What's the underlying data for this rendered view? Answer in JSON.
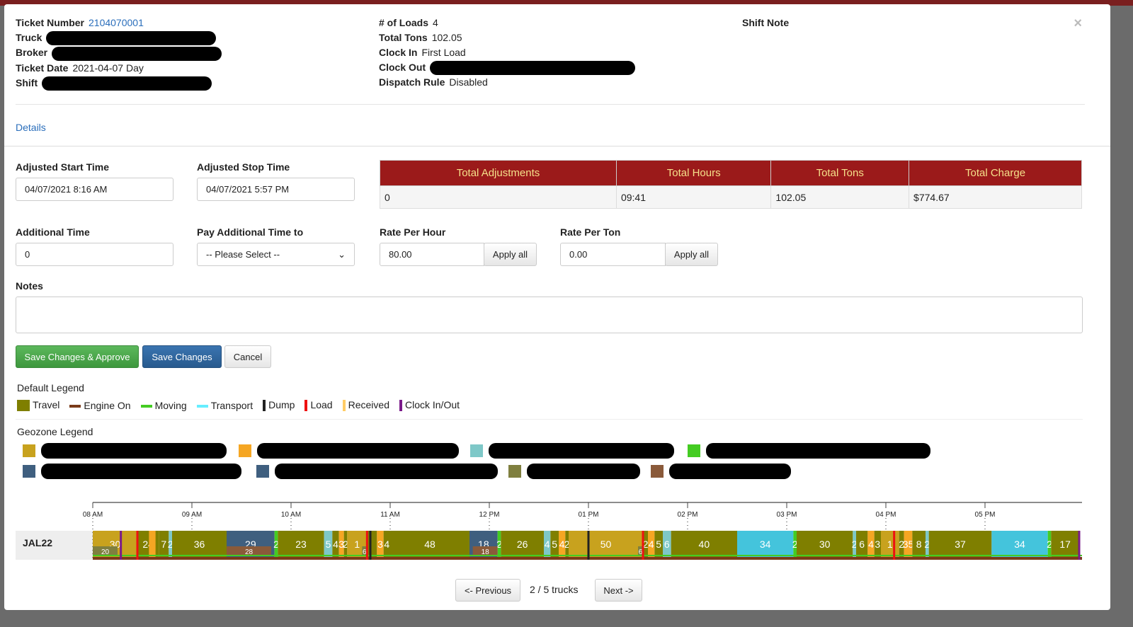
{
  "header": {
    "ticket_number_label": "Ticket Number",
    "ticket_number": "2104070001",
    "truck_label": "Truck",
    "broker_label": "Broker",
    "ticket_date_label": "Ticket Date",
    "ticket_date": "2021-04-07 Day",
    "shift_label": "Shift",
    "loads_label": "# of Loads",
    "loads": "4",
    "total_tons_label": "Total Tons",
    "total_tons": "102.05",
    "clock_in_label": "Clock In",
    "clock_in": "First Load",
    "clock_out_label": "Clock Out",
    "dispatch_rule_label": "Dispatch Rule",
    "dispatch_rule": "Disabled",
    "shift_note_label": "Shift Note",
    "close": "×"
  },
  "details_link": "Details",
  "form": {
    "adj_start_label": "Adjusted Start Time",
    "adj_start": "04/07/2021 8:16 AM",
    "adj_stop_label": "Adjusted Stop Time",
    "adj_stop": "04/07/2021 5:57 PM",
    "additional_time_label": "Additional Time",
    "additional_time": "0",
    "pay_additional_label": "Pay Additional Time to",
    "pay_additional": "-- Please Select --",
    "rate_hour_label": "Rate Per Hour",
    "rate_hour": "80.00",
    "rate_ton_label": "Rate Per Ton",
    "rate_ton": "0.00",
    "apply_all": "Apply all",
    "notes_label": "Notes",
    "notes": "",
    "save_approve": "Save Changes & Approve",
    "save": "Save Changes",
    "cancel": "Cancel"
  },
  "summary": {
    "headers": [
      "Total Adjustments",
      "Total Hours",
      "Total Tons",
      "Total Charge"
    ],
    "values": [
      "0",
      "09:41",
      "102.05",
      "$774.67"
    ]
  },
  "default_legend": {
    "title": "Default Legend",
    "items": [
      {
        "label": "Travel",
        "color": "#7f7f00"
      },
      {
        "label": "Engine On",
        "color": "#7a3b1a"
      },
      {
        "label": "Moving",
        "color": "#44cc22"
      },
      {
        "label": "Transport",
        "color": "#66eeff"
      },
      {
        "label": "Dump",
        "color": "#222222"
      },
      {
        "label": "Load",
        "color": "#ee1111"
      },
      {
        "label": "Received",
        "color": "#ffcc66"
      },
      {
        "label": "Clock In/Out",
        "color": "#7a1a8a"
      }
    ]
  },
  "geozone_legend": {
    "title": "Geozone Legend",
    "colors": [
      "#c8a21e",
      "#f5a623",
      "#7ec8c8",
      "#44cc22",
      "#3f5f7f",
      "#3f5f7f",
      "#7f7f3f",
      "#8a5a3a"
    ]
  },
  "timeline": {
    "truck": "JAL22",
    "ticks": [
      "08 AM",
      "09 AM",
      "10 AM",
      "11 AM",
      "12 PM",
      "01 PM",
      "02 PM",
      "03 PM",
      "04 PM",
      "05 PM"
    ],
    "segments": [
      [
        "08:00",
        "08:27",
        "#c8a21e",
        "30"
      ],
      [
        "08:27",
        "08:40",
        "#7f7f00",
        "24"
      ],
      [
        "08:34",
        "08:38",
        "#f5a623",
        ""
      ],
      [
        "08:40",
        "08:46",
        "#7f7f00",
        "7"
      ],
      [
        "08:46",
        "08:48",
        "#7ec8c8",
        "2"
      ],
      [
        "08:48",
        "09:21",
        "#7f7f00",
        "36"
      ],
      [
        "09:21",
        "09:50",
        "#3f5f7f",
        "29"
      ],
      [
        "09:50",
        "09:52",
        "#44cc22",
        "2"
      ],
      [
        "09:52",
        "10:20",
        "#7f7f00",
        "23"
      ],
      [
        "10:20",
        "10:25",
        "#7ec8c8",
        "5"
      ],
      [
        "10:25",
        "10:29",
        "#7f7f00",
        "4"
      ],
      [
        "10:29",
        "10:32",
        "#f5a623",
        "3"
      ],
      [
        "10:32",
        "10:34",
        "#7f7f00",
        "2"
      ],
      [
        "10:34",
        "10:46",
        "#c8a21e",
        "1"
      ],
      [
        "10:46",
        "10:52",
        "#7f7f00",
        ""
      ],
      [
        "10:52",
        "10:56",
        "#f5a623",
        "3"
      ],
      [
        "10:56",
        "11:00",
        "#7f7f00",
        "4"
      ],
      [
        "11:00",
        "11:48",
        "#7f7f00",
        "48"
      ],
      [
        "11:48",
        "12:05",
        "#3f5f7f",
        "18"
      ],
      [
        "12:05",
        "12:07",
        "#44cc22",
        "2"
      ],
      [
        "12:07",
        "12:33",
        "#7f7f00",
        "26"
      ],
      [
        "12:33",
        "12:37",
        "#7ec8c8",
        "4"
      ],
      [
        "12:37",
        "12:42",
        "#7f7f00",
        "5"
      ],
      [
        "12:42",
        "12:46",
        "#f5a623",
        "4"
      ],
      [
        "12:46",
        "12:48",
        "#7f7f00",
        "2"
      ],
      [
        "12:48",
        "13:33",
        "#c8a21e",
        "50"
      ],
      [
        "13:33",
        "13:36",
        "#7f7f00",
        "2"
      ],
      [
        "13:36",
        "13:40",
        "#f5a623",
        "4"
      ],
      [
        "13:40",
        "13:45",
        "#7f7f00",
        "5"
      ],
      [
        "13:45",
        "13:50",
        "#7ec8c8",
        "6"
      ],
      [
        "13:50",
        "14:30",
        "#7f7f00",
        "40"
      ],
      [
        "14:30",
        "15:04",
        "#44c4dc",
        "34"
      ],
      [
        "15:04",
        "15:06",
        "#44cc22",
        "2"
      ],
      [
        "15:06",
        "15:40",
        "#7f7f00",
        "30"
      ],
      [
        "15:40",
        "15:42",
        "#7ec8c8",
        "2"
      ],
      [
        "15:42",
        "15:49",
        "#7f7f00",
        "6"
      ],
      [
        "15:49",
        "15:53",
        "#f5a623",
        "4"
      ],
      [
        "15:53",
        "15:57",
        "#7f7f00",
        "3"
      ],
      [
        "15:57",
        "16:08",
        "#c8a21e",
        "1"
      ],
      [
        "16:08",
        "16:11",
        "#7f7f00",
        "2"
      ],
      [
        "16:11",
        "16:16",
        "#f5a623",
        "35"
      ],
      [
        "16:16",
        "16:24",
        "#7f7f00",
        "8"
      ],
      [
        "16:24",
        "16:26",
        "#7ec8c8",
        "2"
      ],
      [
        "16:26",
        "17:04",
        "#7f7f00",
        "37"
      ],
      [
        "17:04",
        "17:38",
        "#44c4dc",
        "34"
      ],
      [
        "17:38",
        "17:40",
        "#44cc22",
        "2"
      ],
      [
        "17:40",
        "17:57",
        "#7f7f00",
        "17"
      ]
    ],
    "sub_segments": [
      [
        "08:00",
        "08:15",
        "#7f7f3f",
        "20"
      ],
      [
        "09:21",
        "09:48",
        "#8a5a3a",
        "28"
      ],
      [
        "10:43",
        "10:46",
        "#7f7f3f",
        "6"
      ],
      [
        "11:50",
        "12:05",
        "#8a5a3a",
        "18"
      ],
      [
        "13:30",
        "13:33",
        "#7f7f3f",
        "6"
      ]
    ],
    "markers": [
      [
        "08:17",
        "#7a1a8a"
      ],
      [
        "08:27",
        "#ee1111"
      ],
      [
        "10:46",
        "#ee1111"
      ],
      [
        "10:48",
        "#222222"
      ],
      [
        "13:00",
        "#222222"
      ],
      [
        "13:33",
        "#ee1111"
      ],
      [
        "16:05",
        "#ee1111"
      ],
      [
        "17:57",
        "#7a1a8a"
      ]
    ]
  },
  "pager": {
    "prev": "<- Previous",
    "status": "2 / 5 trucks",
    "next": "Next ->"
  }
}
